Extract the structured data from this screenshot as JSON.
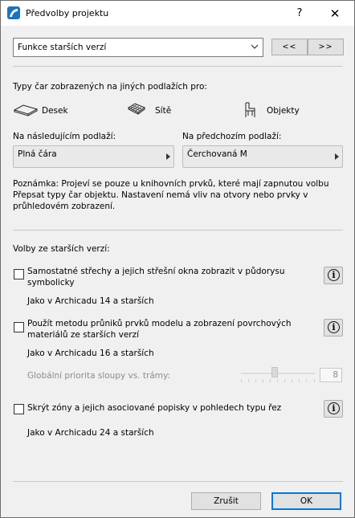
{
  "window": {
    "title": "Předvolby projektu",
    "help_label": "?",
    "close_label": "✕"
  },
  "top": {
    "category_select": {
      "value": "Funkce starších verzí"
    },
    "prev_label": "<<",
    "next_label": ">>"
  },
  "line_types": {
    "heading": "Typy čar zobrazených na jiných podlažích pro:",
    "items": [
      {
        "label": "Desek",
        "icon": "slab-icon"
      },
      {
        "label": "Sítě",
        "icon": "mesh-icon"
      },
      {
        "label": "Objekty",
        "icon": "chair-icon"
      }
    ],
    "next_floor": {
      "label": "Na následujícím podlaží:",
      "value": "Plná čára"
    },
    "prev_floor": {
      "label": "Na předchozím podlaží:",
      "value": "Čerchovaná M"
    },
    "note": [
      "Poznámka: Projeví se pouze u knihovních prvků, které mají zapnutou volbu",
      "Přepsat typy čar objektu. Nastavení nemá vliv na otvory nebo prvky v",
      "průhledovém zobrazení."
    ]
  },
  "legacy": {
    "heading": "Volby ze starších verzí:",
    "options": [
      {
        "lines": [
          "Samostatné střechy a jejich střešní okna zobrazit v půdorysu",
          "symbolicky"
        ],
        "checked": false,
        "sub": "Jako v Archicadu 14 a starších"
      },
      {
        "lines": [
          "Použít metodu průniků prvků modelu a zobrazení povrchových",
          "materiálů ze starších verzí"
        ],
        "checked": false,
        "sub": "Jako v Archicadu 16 a starších"
      },
      {
        "lines": [
          "Skrýt zóny a jejich asociované popisky v pohledech typu řez"
        ],
        "checked": false,
        "sub": "Jako v Archicadu 24 a starších"
      }
    ],
    "priority": {
      "label": "Globální priorita sloupy vs. trámy:",
      "value": "8",
      "slider_fraction": 0.45
    }
  },
  "footer": {
    "cancel_label": "Zrušit",
    "ok_label": "OK"
  },
  "colors": {
    "accent": "#0078d7",
    "dialog_bg": "#f0f0f0"
  }
}
